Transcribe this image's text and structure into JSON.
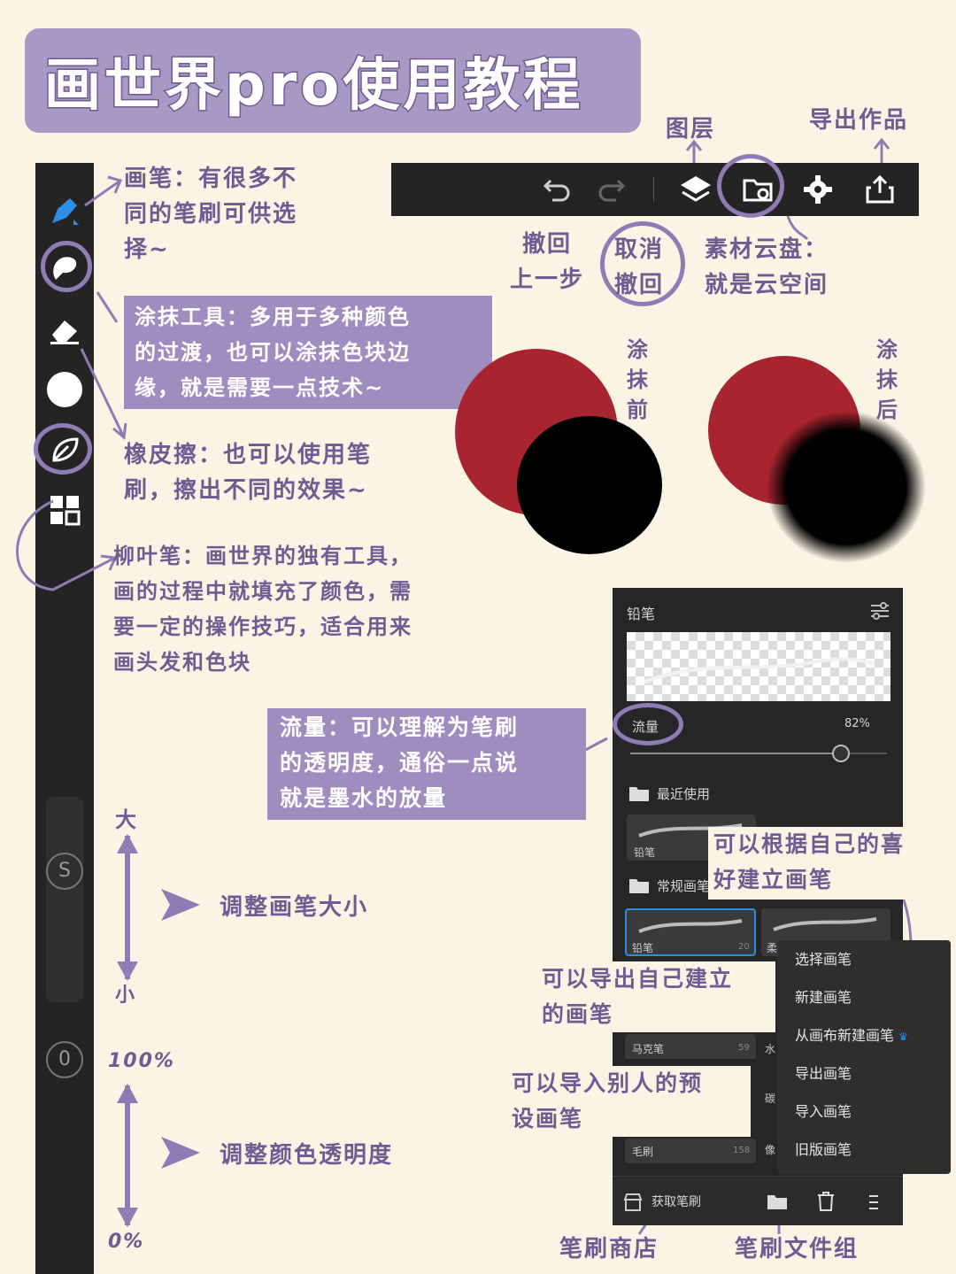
{
  "title": "画世界pro使用教程",
  "topbar": {
    "labels": {
      "layers": "图层",
      "export_work": "导出作品",
      "undo": "撤回\n上一步",
      "redo": "取消\n撤回",
      "cloud": "素材云盘：\n就是云空间"
    }
  },
  "notes": {
    "brush": "画笔：有很多不\n同的笔刷可供选\n择~",
    "smudge": "涂抹工具：多用于多种颜色\n的过渡，也可以涂抹色块边\n缘，就是需要一点技术~",
    "eraser": "橡皮擦：也可以使用笔\n刷，擦出不同的效果~",
    "willow": "柳叶笔：画世界的独有工具，\n画的过程中就填充了颜色，需\n要一定的操作技巧，适合用来\n画头发和色块",
    "flow": "流量：可以理解为笔刷\n的透明度，通俗一点说\n就是墨水的放量",
    "before": "涂\n抹\n前",
    "after": "涂\n抹\n后",
    "size_big": "大",
    "size_small": "小",
    "size": "调整画笔大小",
    "op_100": "100%",
    "op_0": "0%",
    "opacity": "调整颜色透明度",
    "custom": "可以根据自己的喜\n好建立画笔",
    "export_brush": "可以导出自己建立\n的画笔",
    "import_brush": "可以导入别人的预\n设画笔",
    "store": "笔刷商店",
    "folder": "笔刷文件组"
  },
  "sidebar": {
    "size_badge": "S",
    "opacity_badge": "0"
  },
  "panel": {
    "header": "铅笔",
    "flow_label": "流量",
    "flow_value": "82%",
    "flow_fraction": 0.82,
    "recent": "最近使用",
    "recent_item": "铅笔",
    "regular": "常规画笔",
    "sel_item": "铅笔",
    "sel_count": "20",
    "side_item": "柔",
    "marker": "马克笔",
    "marker_count": "59",
    "water": "水",
    "carbon": "碳",
    "pixel": "像",
    "brush_hair": "毛刷",
    "brush_hair_count": "158",
    "get_brush": "获取笔刷"
  },
  "menu": [
    "选择画笔",
    "新建画笔",
    "从画布新建画笔",
    "导出画笔",
    "导入画笔",
    "旧版画笔"
  ],
  "colors": {
    "accent": "#8f7cb4",
    "red": "#a8242e",
    "black": "#000000"
  }
}
